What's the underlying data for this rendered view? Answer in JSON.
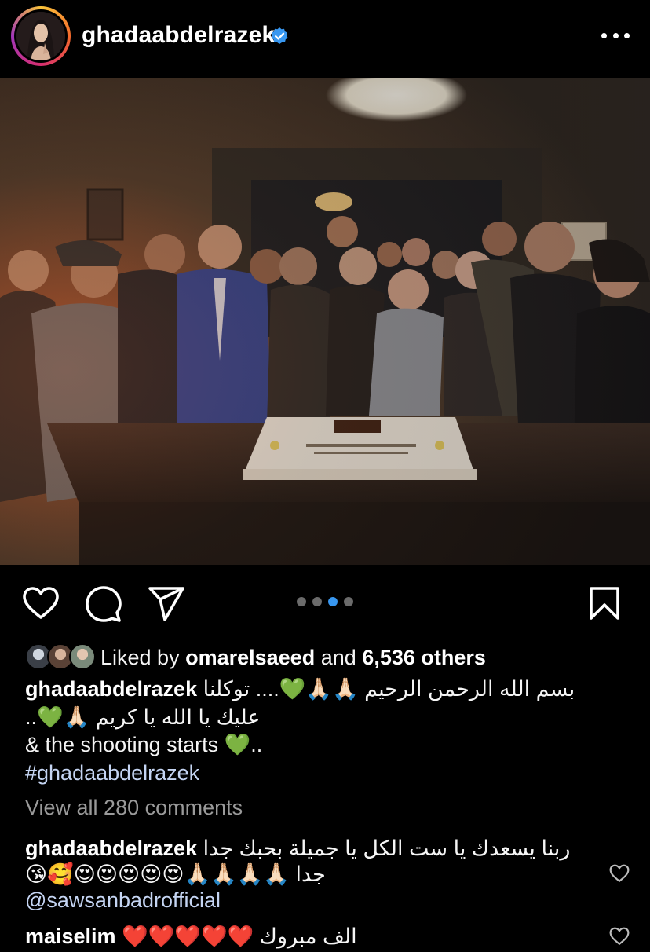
{
  "header": {
    "username": "ghadaabdelrazek",
    "verified": true,
    "more_icon": "more-horizontal-icon"
  },
  "post": {
    "carousel": {
      "count": 4,
      "active_index": 2
    }
  },
  "likes": {
    "prefix": "Liked by",
    "user": "omarelsaeed",
    "connector": "and",
    "others": "6,536 others"
  },
  "caption": {
    "username": "ghadaabdelrazek",
    "line1_text": "بسم الله الرحمن الرحيم 🙏🏻🙏🏻💚.... توكلنا",
    "line2_text": "عليك يا الله يا كريم 🙏🏻💚..",
    "line3_text": "& the shooting starts 💚..",
    "hashtag": "#ghadaabdelrazek"
  },
  "view_all_comments": "View all 280 comments",
  "comments": [
    {
      "username": "ghadaabdelrazek",
      "line1": "ربنا يسعدك يا ست الكل يا جميلة بحبك جدا",
      "line2": "جدا 🙏🏻🙏🏻🙏🏻🙏🏻😍😍😍😍😍🥰😘",
      "mention": "@sawsanbadrofficial"
    },
    {
      "username": "maiselim",
      "text": "الف مبروك ❤️❤️❤️❤️❤️"
    }
  ],
  "colors": {
    "background": "#000000",
    "text": "#f5f5f5",
    "muted": "#9a9a9a",
    "hashtag": "#c5d5f3",
    "accent_blue": "#3897f0",
    "verified_blue": "#3897f0"
  }
}
